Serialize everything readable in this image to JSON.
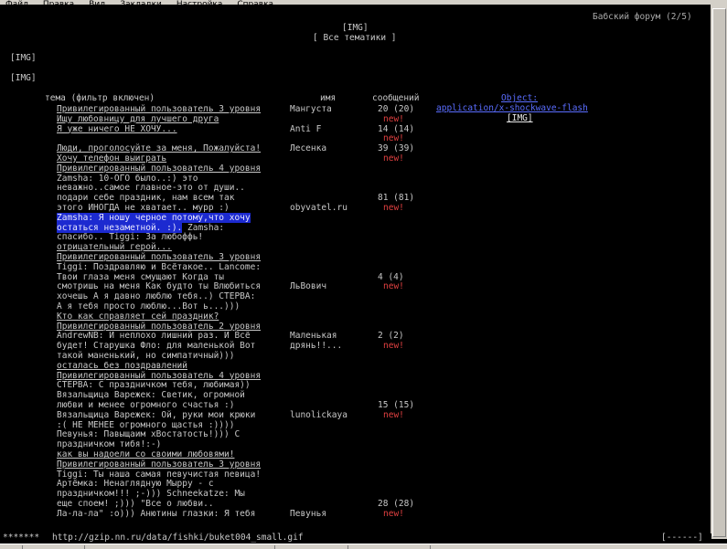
{
  "menu": [
    "Файл",
    "Правка",
    "Вид",
    "Закладки",
    "Настройка",
    "Справка"
  ],
  "window_title": "Бабский форум (2/5)",
  "header": {
    "img": "[IMG]",
    "all_topics": "[ Все тематики ]"
  },
  "img1": "[IMG]",
  "img2": "[IMG]",
  "columns": {
    "topic": "тема (фильтр включен)",
    "name": "имя",
    "messages": "сообщений",
    "object": "Object:",
    "mime": "application/x-shockwave-flash",
    "obj_img": "[IMG]"
  },
  "new_label": "new!",
  "lines": [
    {
      "t": "Привилегированный пользователь 3 уровня",
      "s": "u",
      "n": "Мангуста",
      "c": "20 (20)"
    },
    {
      "t": "Ищу любовницу для лучшего друга",
      "s": "u",
      "new": true
    },
    {
      "t": "Я уже ничего НЕ ХОЧУ...",
      "s": "u",
      "n": "Anti F",
      "c": "14 (14)"
    },
    {
      "new": true
    },
    {
      "t": "Люди, проголосуйте за меня, Пожалуйста!",
      "s": "u",
      "n": "Лесенка",
      "c": "39 (39)"
    },
    {
      "t": "Хочу телефон выиграть",
      "s": "u",
      "new": true
    },
    {
      "t": "Привилегированный пользователь 4 уровня",
      "s": "u"
    },
    {
      "t": "Zamsha: 10-ОГО было..:) это"
    },
    {
      "t": "неважно..самое главное-это от души.."
    },
    {
      "t": "подари себе праздник, нам всем так",
      "c": "81 (81)"
    },
    {
      "t": "этого ИНОГДА не хватает.. мурр :)",
      "n": "obyvatel.ru",
      "new": true
    },
    {
      "t": "Zamsha: Я ношу черное потому,что хочу",
      "s": "hl"
    },
    {
      "t": "остаться незаметной. :).",
      "s": "hl",
      "t2": " Zamsha:"
    },
    {
      "t": "спасибо.. Tiggi: За любоффь!"
    },
    {
      "t": "отрицательный герой...",
      "s": "u"
    },
    {
      "t": "Привилегированный пользователь 3 уровня",
      "s": "u"
    },
    {
      "t": "Tiggi: Поздравляю и Всётакое.. Lancome:"
    },
    {
      "t": "Твои глаза меня смущают Когда ты",
      "c": "4 (4)"
    },
    {
      "t": "смотришь на меня Как будто ты Влюбиться",
      "n": "ЛьВович",
      "new": true
    },
    {
      "t": "хочешь А я давно люблю тебя..) СТЕРВА:"
    },
    {
      "t": "А я тебя просто люблю...Вот ь...)))"
    },
    {
      "t": "Кто как справляет сей праздник?",
      "s": "u"
    },
    {
      "t": "Привилегированный пользователь 2 уровня",
      "s": "u"
    },
    {
      "t": "AndrewNB: И неплохо лишний раз. И Всё",
      "n": "Маленькая",
      "c": "2 (2)"
    },
    {
      "t": "будет! Старушка Фло: для маленькой Вот",
      "n": "дрянь!!...",
      "new": true
    },
    {
      "t": "такой маненький, но симпатичный)))"
    },
    {
      "t": "осталась без поздравлений",
      "s": "u"
    },
    {
      "t": "Привилегированный пользователь 4 уровня",
      "s": "u"
    },
    {
      "t": "СТЕРВА: С праздничком тебя, любимая))"
    },
    {
      "t": "Вязальщица Варежек: Светик, огромной"
    },
    {
      "t": "любви и менее огромного счастья :)",
      "c": "15 (15)"
    },
    {
      "t": "Вязальщица Варежек: Ой, руки мои крюки",
      "n": "lunolickaya",
      "new": true
    },
    {
      "t": ":( НЕ МЕНЕЕ огромного щастья :))))"
    },
    {
      "t": "Певунья: Павыщаим хВостатость!))) С"
    },
    {
      "t": "праздничком тибя!:-)"
    },
    {
      "t": "как вы надоели со своими любовями!",
      "s": "u"
    },
    {
      "t": "Привилегированный пользователь 3 уровня",
      "s": "u"
    },
    {
      "t": "Tiggi: Ты наша самая певучистая певица!"
    },
    {
      "t": "Артёмка: Ненаглядную Мырру - с"
    },
    {
      "t": "праздничком!!! ;-))) Schneekatze: Мы"
    },
    {
      "t": "еще споем! ;))) \"Все о любви..",
      "c": "28 (28)"
    },
    {
      "t": "Ла-ла-ла\" :o))) Анютины глазки: Я тебя",
      "n": "Певунья",
      "new": true
    }
  ],
  "status": {
    "prefix": "*******",
    "url": "http://gzip.nn.ru/data/fishki/buket004_small.gif",
    "right": "[------]"
  }
}
